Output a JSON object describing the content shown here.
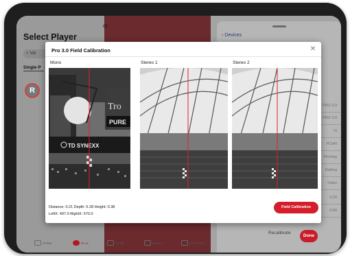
{
  "background": {
    "title": "Select Player",
    "search_value": "Vel",
    "tab_single": "Single P",
    "avatar_letter": "R",
    "devices_link": "‹ Devices",
    "sidebar_labels": [
      "PRO 3.0",
      "PRO 3.0",
      "SI",
      "PCHN",
      "Pitching",
      "Batting",
      "Video",
      "4.20",
      "0:00"
    ],
    "recalibrate_label": "Recalibrate",
    "done_label": "Done",
    "nav": [
      {
        "label": "HOME",
        "icon": "home-icon"
      },
      {
        "label": "PLAY",
        "icon": "play-icon",
        "active": true
      },
      {
        "label": "TEAM",
        "icon": "team-icon"
      },
      {
        "label": "DRILLS",
        "icon": "drills-icon"
      },
      {
        "label": "SETTINGS",
        "icon": "settings-icon"
      }
    ]
  },
  "modal": {
    "title": "Pro 3.0 Field Calibration",
    "cameras": [
      "Mono",
      "Stereo 1",
      "Stereo 2"
    ],
    "stats_line1": "Distance: 0.21   Depth: 5.28 Height: 0.38",
    "stats_line2": "LeftX: 497.0 RightX: 570.0",
    "field_calibration_label": "Field Calibration",
    "mono_sign_brand": "TD SYNEXX",
    "mono_sign_text": "Tro",
    "mono_sign_text2": "PURE",
    "colors": {
      "accent": "#d41e2c",
      "calibration_line": "#e0202c"
    }
  }
}
